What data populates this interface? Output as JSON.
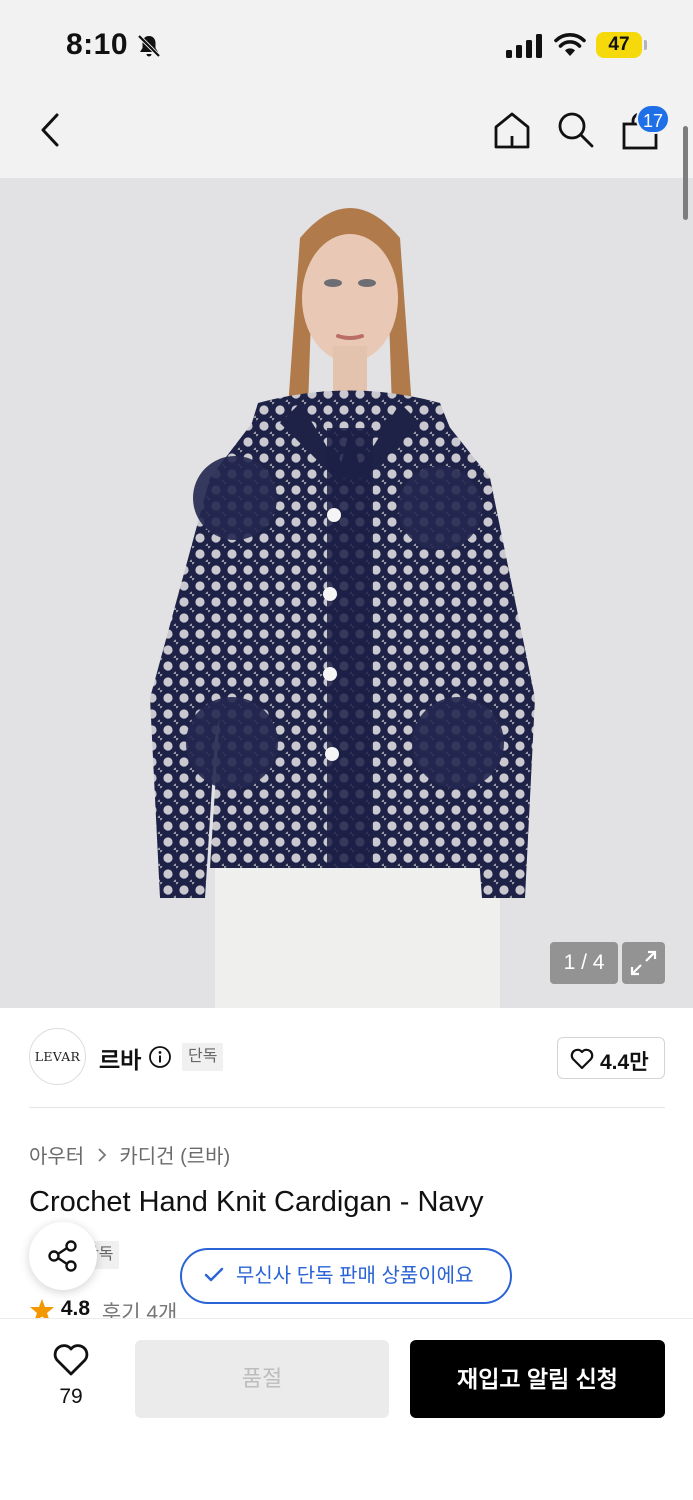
{
  "status_bar": {
    "time": "8:10",
    "battery": "47",
    "icons": [
      "bell-slash-icon",
      "cellular-signal-icon",
      "wifi-icon",
      "battery-icon"
    ],
    "battery_color": "#f5d90a"
  },
  "header": {
    "icons": [
      "back-chevron-icon",
      "home-icon",
      "search-icon",
      "shopping-bag-icon"
    ],
    "cart_badge": "17",
    "badge_color": "#1e6fe8"
  },
  "gallery": {
    "pager": "1 / 4",
    "expand_icon": "expand-arrows-icon"
  },
  "brand": {
    "logo_text": "LEVAR",
    "name": "르바",
    "exclusive_tag": "단독",
    "like_count": "4.4만",
    "info_icon": "info-icon",
    "heart_icon": "heart-outline-icon"
  },
  "breadcrumb": {
    "items": [
      "아우터",
      "카디건 (르바)"
    ]
  },
  "product": {
    "title": "Crochet Hand Knit Cardigan - Navy",
    "tag_partial": "단독",
    "rating": "4.8",
    "review_label": "후기 4개",
    "rating_color": "#f39800"
  },
  "exclusive_notice": {
    "text": "무신사 단독 판매 상품이에요",
    "color": "#2a63d6"
  },
  "share": {
    "icon": "share-icon"
  },
  "bottom_bar": {
    "wish_count": "79",
    "soldout_label": "품절",
    "restock_label": "재입고 알림 신청"
  }
}
